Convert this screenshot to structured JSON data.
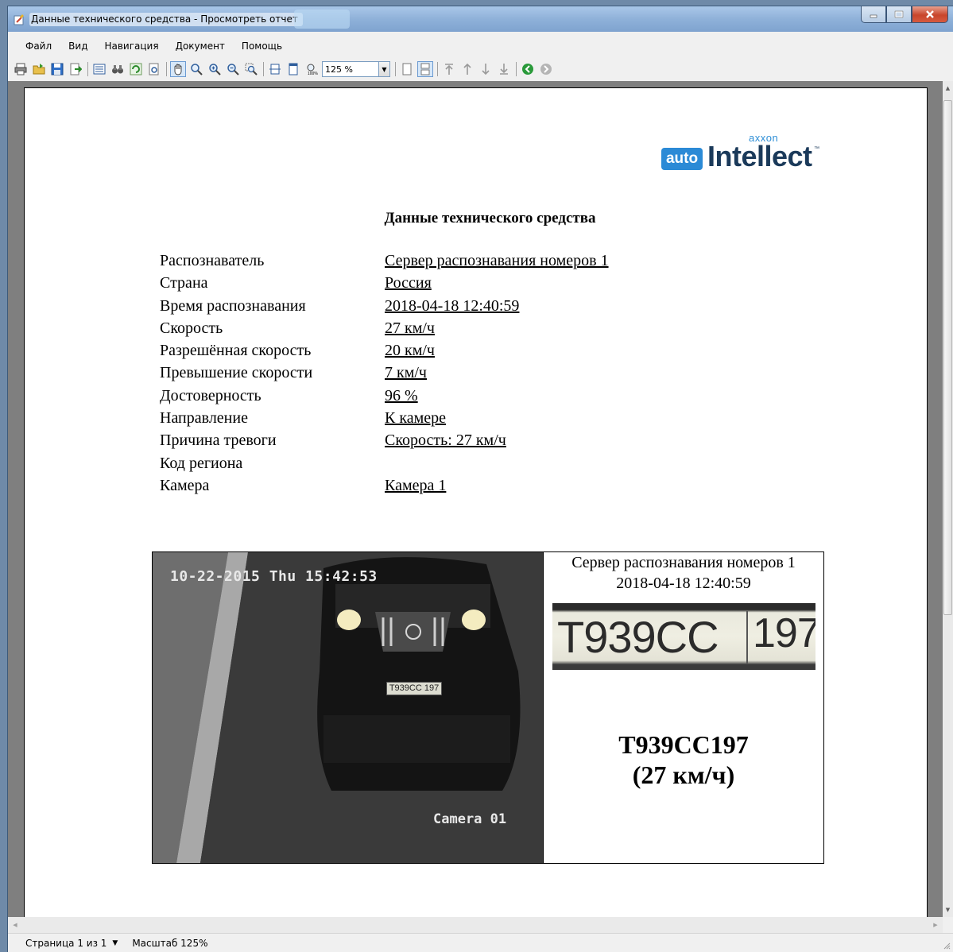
{
  "window": {
    "title": "Данные технического средства - Просмотреть отчет"
  },
  "menu": {
    "items": [
      "Файл",
      "Вид",
      "Навигация",
      "Документ",
      "Помощь"
    ]
  },
  "toolbar": {
    "zoom_value": "125 %"
  },
  "report": {
    "logo": {
      "brand_small": "axxon",
      "badge": "auto",
      "name": "Intellect",
      "tm": "™"
    },
    "title": "Данные технического средства",
    "properties": [
      {
        "label": "Распознаватель",
        "value": "Сервер распознавания номеров 1"
      },
      {
        "label": "Страна",
        "value": "Россия"
      },
      {
        "label": "Время распознавания",
        "value": "2018-04-18 12:40:59"
      },
      {
        "label": "Скорость",
        "value": "27 км/ч"
      },
      {
        "label": "Разрешённая скорость",
        "value": "20 км/ч"
      },
      {
        "label": "Превышение скорости",
        "value": "7 км/ч"
      },
      {
        "label": "Достоверность",
        "value": "96 %"
      },
      {
        "label": "Направление",
        "value": "К камере"
      },
      {
        "label": "Причина тревоги",
        "value": "Скорость: 27 км/ч"
      },
      {
        "label": "Код региона",
        "value": ""
      },
      {
        "label": "Камера",
        "value": "Камера 1"
      }
    ],
    "event": {
      "camera_timestamp": "10-22-2015 Thu 15:42:53",
      "camera_name": "Camera 01",
      "small_plate": "T939CC 197",
      "server": "Сервер распознавания номеров 1",
      "datetime": "2018-04-18 12:40:59",
      "plate_crop_main": "T939CC",
      "plate_crop_region": "197",
      "plate_number": "T939CC197",
      "speed": "(27 км/ч)"
    }
  },
  "status": {
    "page": "Страница 1 из 1",
    "zoom": "Масштаб 125%"
  }
}
